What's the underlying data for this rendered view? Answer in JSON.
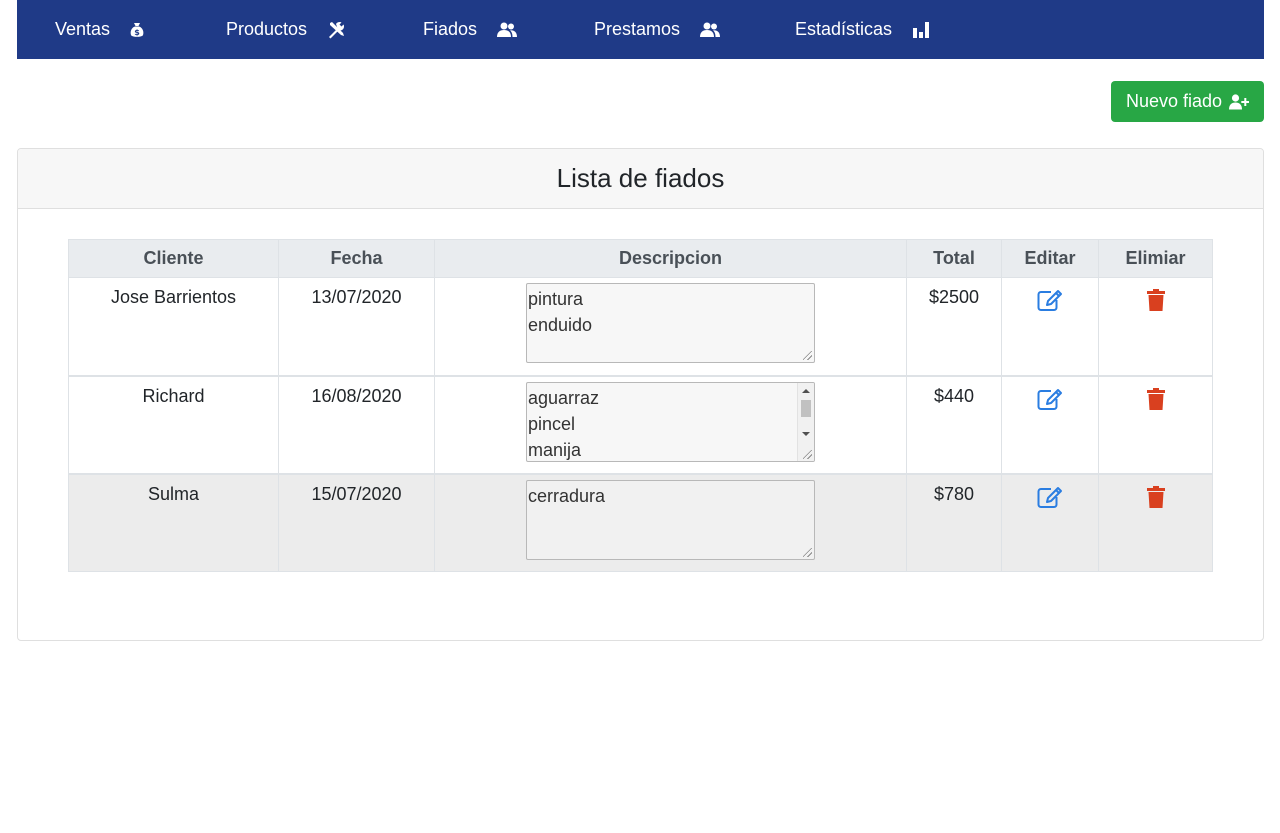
{
  "nav": {
    "items": [
      {
        "label": "Ventas",
        "icon": "money-bag-icon"
      },
      {
        "label": "Productos",
        "icon": "tools-icon"
      },
      {
        "label": "Fiados",
        "icon": "users-icon"
      },
      {
        "label": "Prestamos",
        "icon": "users-icon"
      },
      {
        "label": "Estadísticas",
        "icon": "bar-chart-icon"
      }
    ]
  },
  "actions": {
    "new_label": "Nuevo fiado",
    "new_icon": "user-plus-icon"
  },
  "card": {
    "title": "Lista de fiados"
  },
  "table": {
    "headers": [
      "Cliente",
      "Fecha",
      "Descripcion",
      "Total",
      "Editar",
      "Elimiar"
    ],
    "rows": [
      {
        "cliente": "Jose Barrientos",
        "fecha": "13/07/2020",
        "descripcion": [
          "pintura",
          "enduido"
        ],
        "total": "$2500"
      },
      {
        "cliente": "Richard",
        "fecha": "16/08/2020",
        "descripcion": [
          "aguarraz",
          "pincel",
          "manija"
        ],
        "total": "$440"
      },
      {
        "cliente": "Sulma",
        "fecha": "15/07/2020",
        "descripcion": [
          "cerradura"
        ],
        "total": "$780"
      }
    ]
  },
  "colors": {
    "navbar": "#1f3a87",
    "success": "#28a745",
    "edit": "#2a7de1",
    "delete": "#d9401f"
  }
}
